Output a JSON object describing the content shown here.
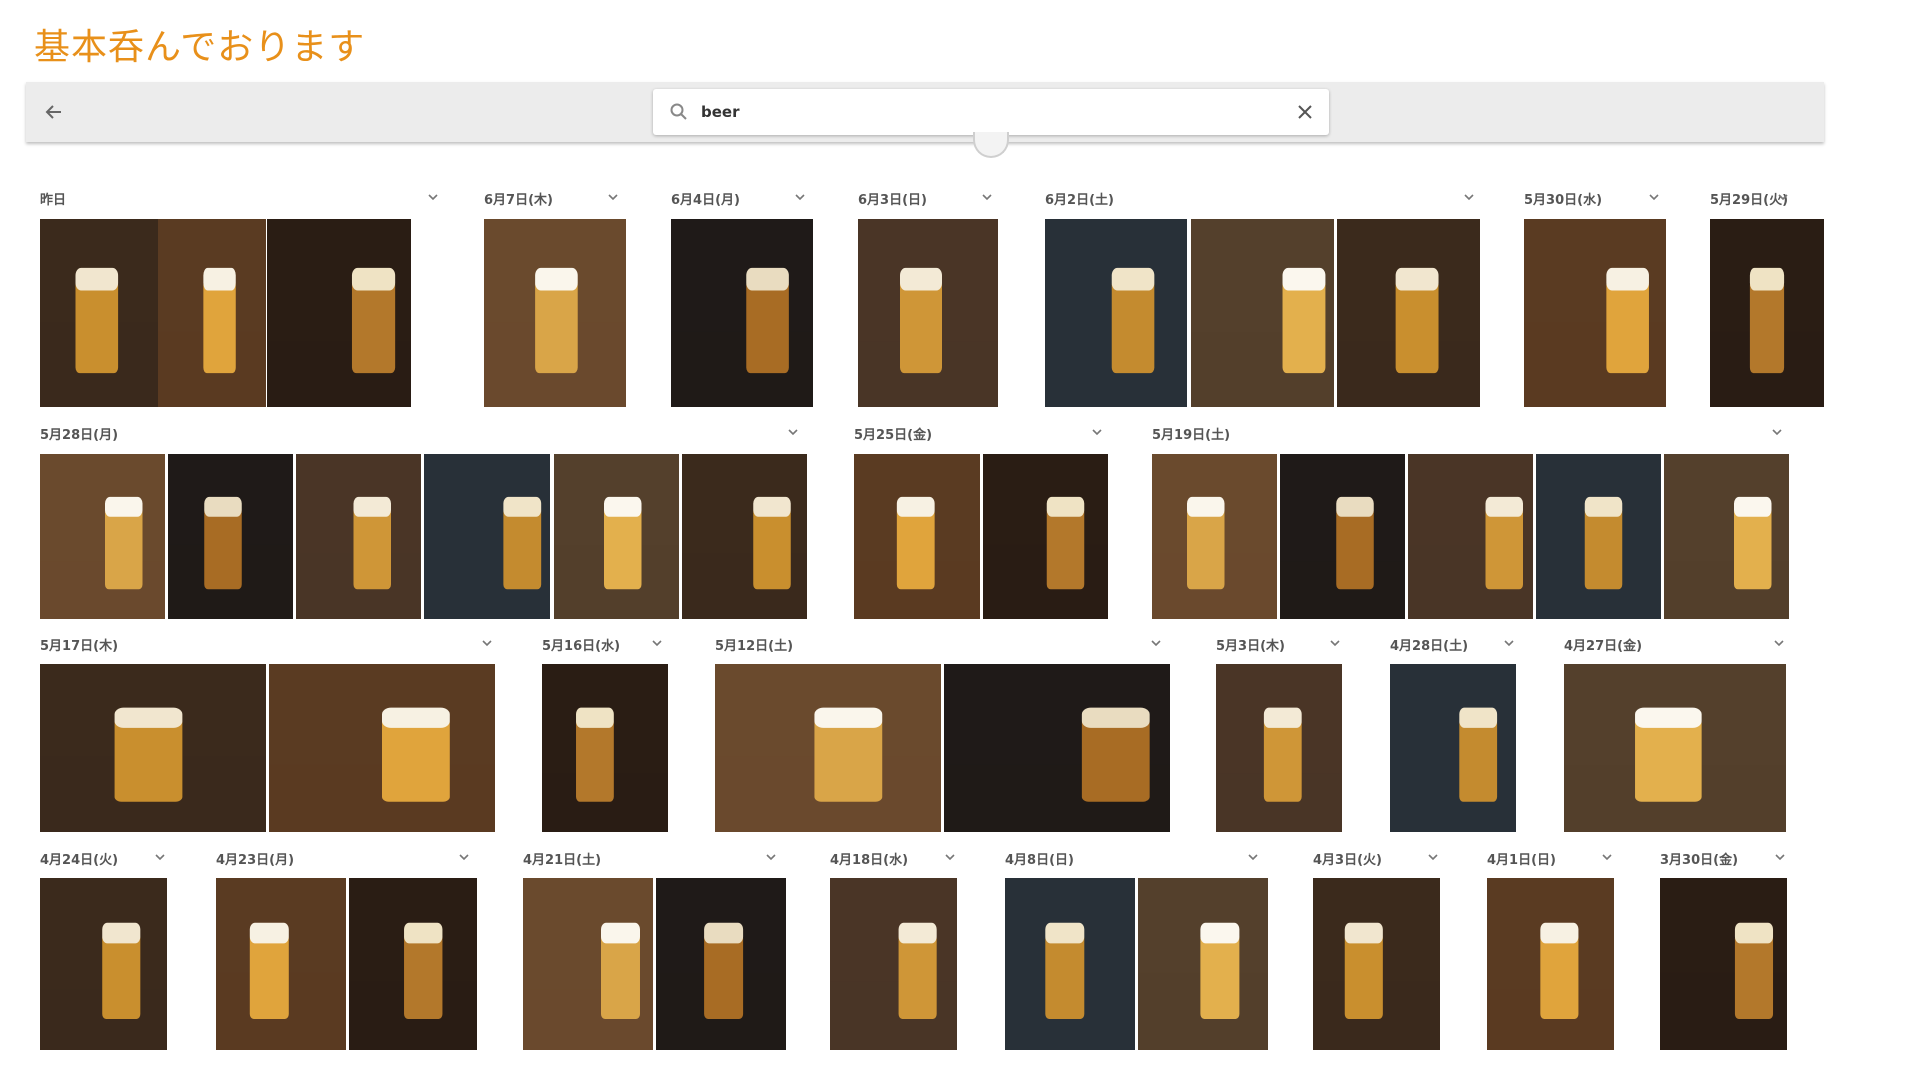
{
  "page_title": "基本呑んでおります",
  "search": {
    "query": "beer",
    "back_icon": "arrow-left-icon",
    "search_icon": "search-icon",
    "clear_icon": "close-icon"
  },
  "groups": [
    {
      "date": "昨日",
      "photo_count": 3
    },
    {
      "date": "6月7日(木)",
      "photo_count": 1
    },
    {
      "date": "6月4日(月)",
      "photo_count": 1
    },
    {
      "date": "6月3日(日)",
      "photo_count": 1
    },
    {
      "date": "6月2日(土)",
      "photo_count": 3
    },
    {
      "date": "5月30日(水)",
      "photo_count": 1
    },
    {
      "date": "5月29日(火)",
      "photo_count": 1
    },
    {
      "date": "5月28日(月)",
      "photo_count": 6
    },
    {
      "date": "5月25日(金)",
      "photo_count": 2
    },
    {
      "date": "5月19日(土)",
      "photo_count": 5
    },
    {
      "date": "5月17日(木)",
      "photo_count": 2
    },
    {
      "date": "5月16日(水)",
      "photo_count": 1
    },
    {
      "date": "5月12日(土)",
      "photo_count": 2
    },
    {
      "date": "5月3日(木)",
      "photo_count": 1
    },
    {
      "date": "4月28日(土)",
      "photo_count": 1
    },
    {
      "date": "4月27日(金)",
      "photo_count": 1
    },
    {
      "date": "4月24日(火)",
      "photo_count": 1
    },
    {
      "date": "4月23日(月)",
      "photo_count": 2
    },
    {
      "date": "4月21日(土)",
      "photo_count": 2
    },
    {
      "date": "4月18日(水)",
      "photo_count": 1
    },
    {
      "date": "4月8日(日)",
      "photo_count": 2
    },
    {
      "date": "4月3日(火)",
      "photo_count": 1
    },
    {
      "date": "4月1日(日)",
      "photo_count": 1
    },
    {
      "date": "3月30日(金)",
      "photo_count": 1
    }
  ],
  "colors": {
    "title": "#e8901a",
    "toolbar": "#ececec",
    "date_text": "#555555"
  }
}
